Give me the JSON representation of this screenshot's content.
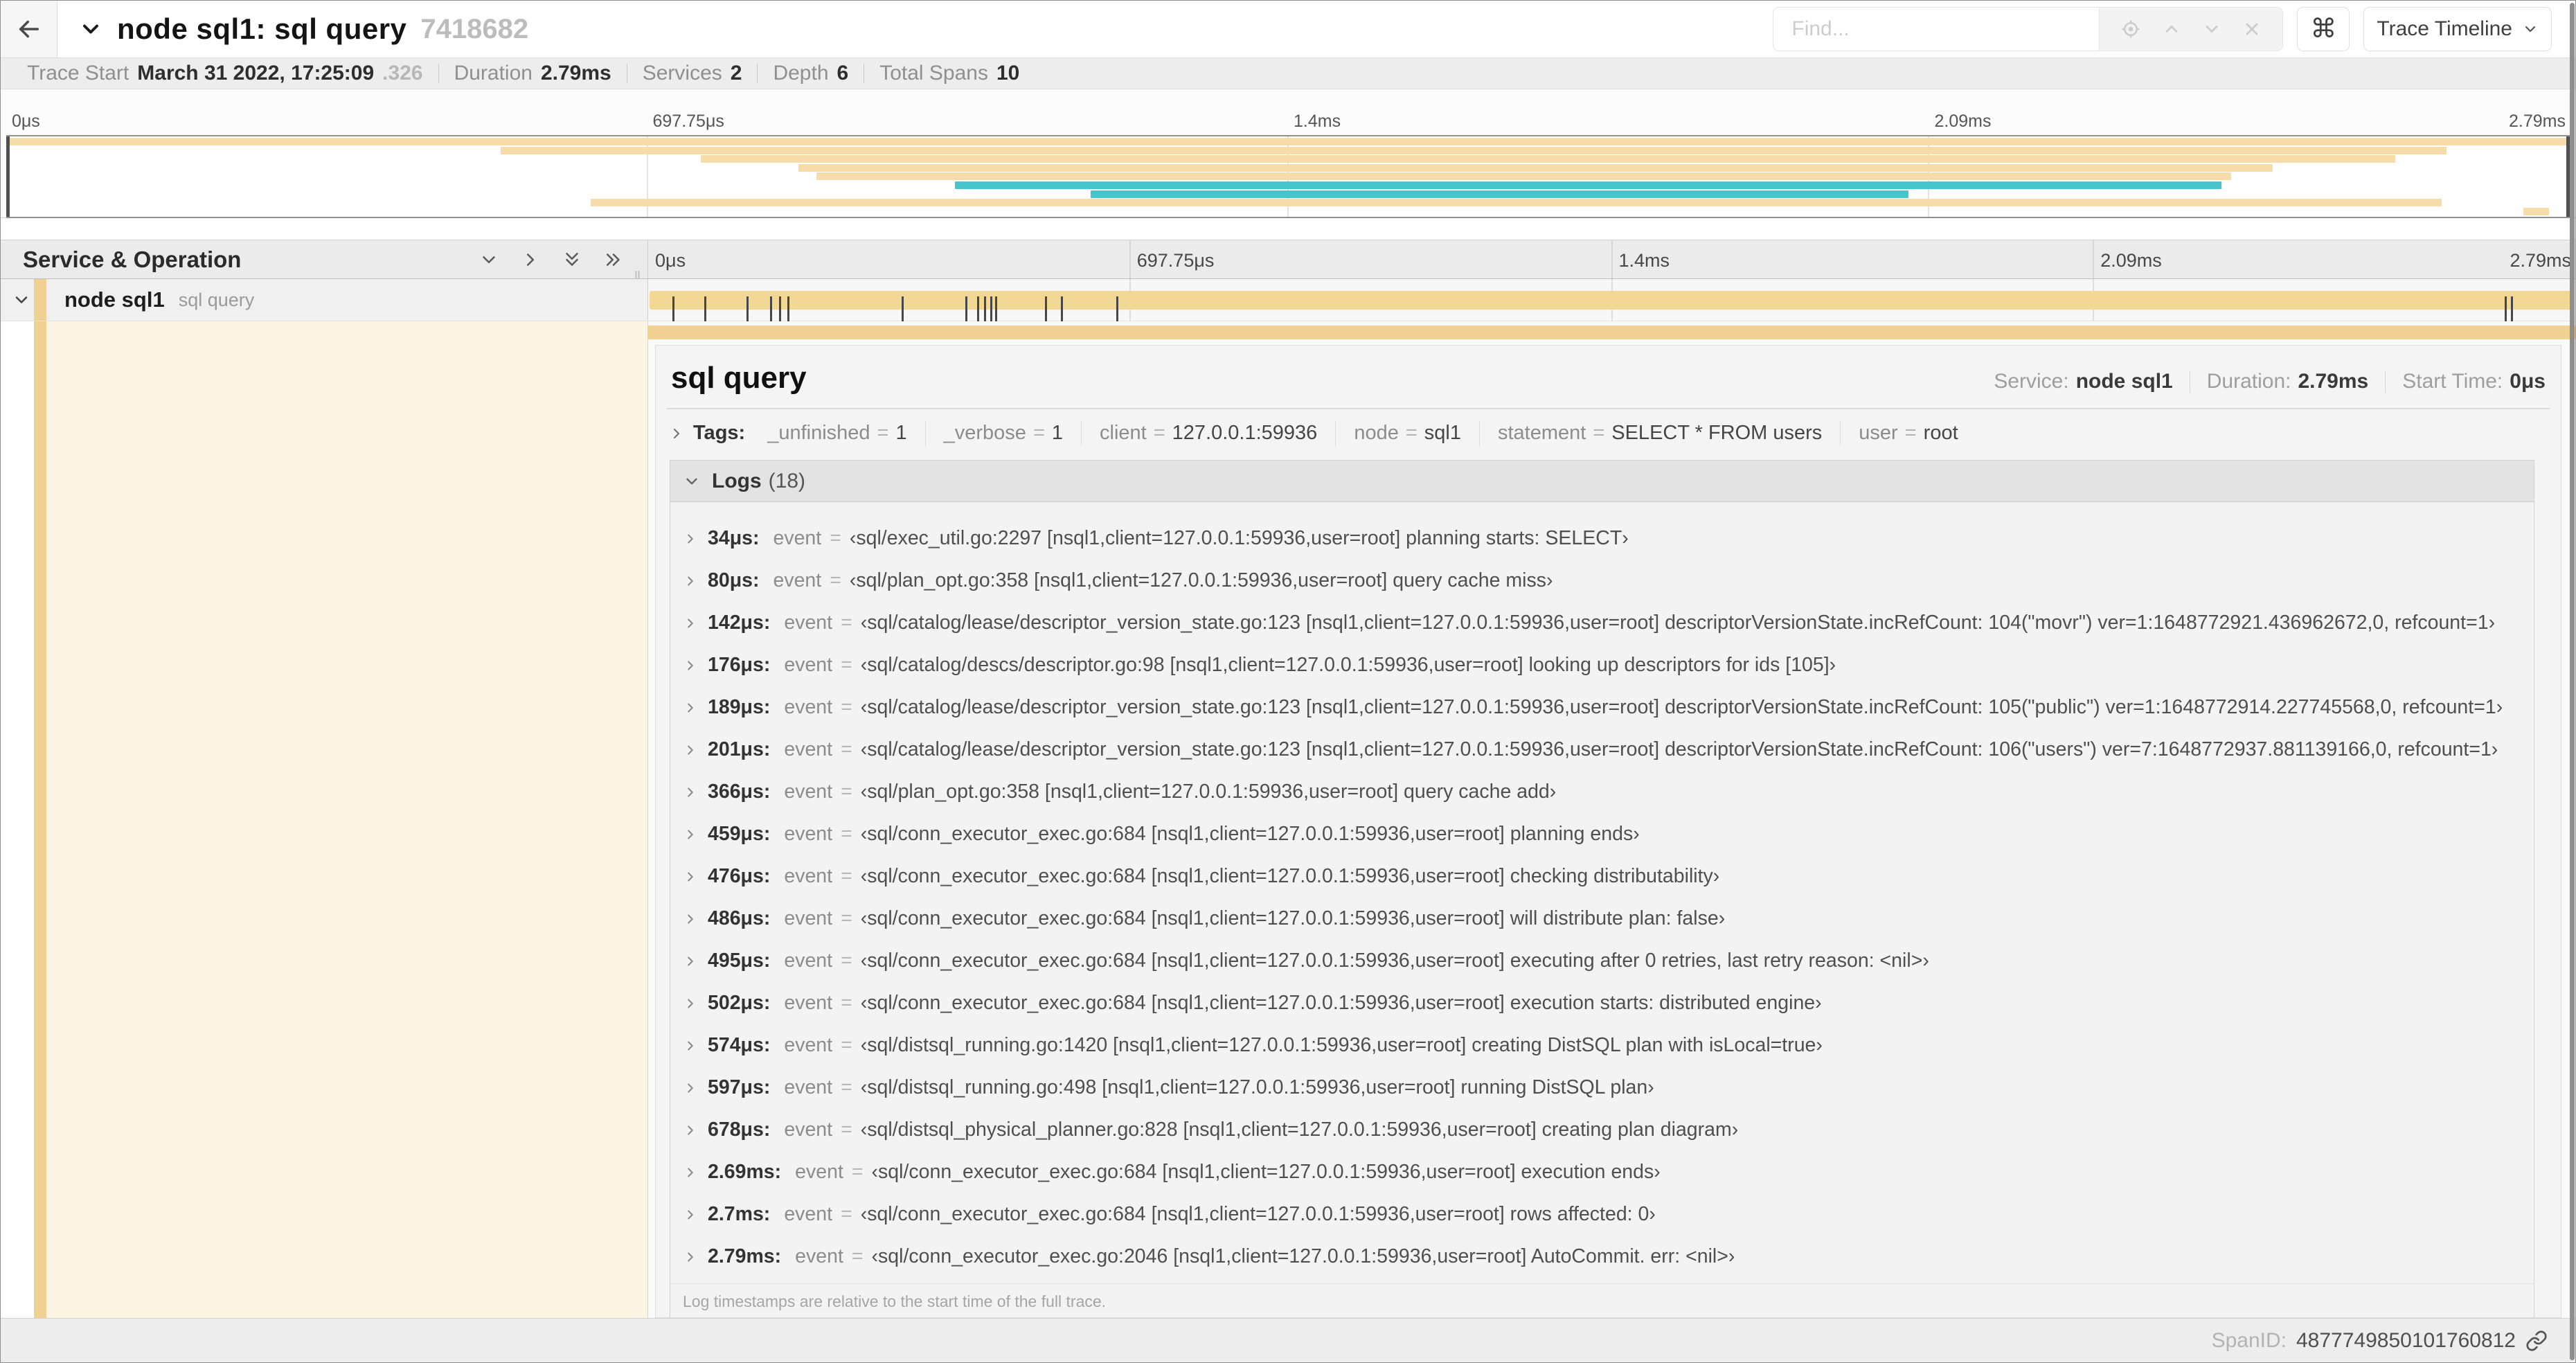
{
  "nav": {
    "title": "node sql1: sql query",
    "trace_id": "7418682",
    "find_placeholder": "Find...",
    "shortcut_icon": "⌘",
    "view_selector": "Trace Timeline"
  },
  "stats": [
    {
      "label": "Trace Start",
      "value": "March 31 2022, 17:25:09",
      "suffix": ".326"
    },
    {
      "label": "Duration",
      "value": "2.79ms"
    },
    {
      "label": "Services",
      "value": "2"
    },
    {
      "label": "Depth",
      "value": "6"
    },
    {
      "label": "Total Spans",
      "value": "10"
    }
  ],
  "ruler": [
    {
      "label": "0μs",
      "pct": 0
    },
    {
      "label": "697.75μs",
      "pct": 25
    },
    {
      "label": "1.4ms",
      "pct": 50
    },
    {
      "label": "2.09ms",
      "pct": 75
    },
    {
      "label": "2.79ms",
      "pct": 100
    }
  ],
  "minimap_spans": [
    {
      "start": 0,
      "end": 100,
      "color": "tan"
    },
    {
      "start": 19.3,
      "end": 95.2,
      "color": "tan"
    },
    {
      "start": 27.1,
      "end": 93.2,
      "color": "tan"
    },
    {
      "start": 30.9,
      "end": 88.4,
      "color": "tan"
    },
    {
      "start": 31.6,
      "end": 86.8,
      "color": "tan"
    },
    {
      "start": 37.0,
      "end": 86.4,
      "color": "teal"
    },
    {
      "start": 42.3,
      "end": 74.2,
      "color": "teal"
    },
    {
      "start": 22.8,
      "end": 95.0,
      "color": "tan"
    },
    {
      "start": 98.2,
      "end": 99.2,
      "color": "tan"
    }
  ],
  "column_header": "Service & Operation",
  "row": {
    "service": "node sql1",
    "operation": "sql query"
  },
  "detail": {
    "operation": "sql query",
    "meta": [
      {
        "label": "Service:",
        "value": "node sql1"
      },
      {
        "label": "Duration:",
        "value": "2.79ms"
      },
      {
        "label": "Start Time:",
        "value": "0μs"
      }
    ],
    "tags_label": "Tags:",
    "tags": [
      {
        "key": "_unfinished",
        "value": "1"
      },
      {
        "key": "_verbose",
        "value": "1"
      },
      {
        "key": "client",
        "value": "127.0.0.1:59936"
      },
      {
        "key": "node",
        "value": "sql1"
      },
      {
        "key": "statement",
        "value": "SELECT * FROM users"
      },
      {
        "key": "user",
        "value": "root"
      }
    ],
    "logs_label": "Logs",
    "logs_count": "(18)",
    "logs": [
      {
        "time": "34μs:",
        "pct": 1.22,
        "field": "event",
        "value": "‹sql/exec_util.go:2297 [nsql1,client=127.0.0.1:59936,user=root] planning starts: SELECT›"
      },
      {
        "time": "80μs:",
        "pct": 2.87,
        "field": "event",
        "value": "‹sql/plan_opt.go:358 [nsql1,client=127.0.0.1:59936,user=root] query cache miss›"
      },
      {
        "time": "142μs:",
        "pct": 5.09,
        "field": "event",
        "value": "‹sql/catalog/lease/descriptor_version_state.go:123 [nsql1,client=127.0.0.1:59936,user=root] descriptorVersionState.incRefCount: 104(\"movr\") ver=1:1648772921.436962672,0, refcount=1›"
      },
      {
        "time": "176μs:",
        "pct": 6.31,
        "field": "event",
        "value": "‹sql/catalog/descs/descriptor.go:98 [nsql1,client=127.0.0.1:59936,user=root] looking up descriptors for ids [105]›"
      },
      {
        "time": "189μs:",
        "pct": 6.77,
        "field": "event",
        "value": "‹sql/catalog/lease/descriptor_version_state.go:123 [nsql1,client=127.0.0.1:59936,user=root] descriptorVersionState.incRefCount: 105(\"public\") ver=1:1648772914.227745568,0, refcount=1›"
      },
      {
        "time": "201μs:",
        "pct": 7.2,
        "field": "event",
        "value": "‹sql/catalog/lease/descriptor_version_state.go:123 [nsql1,client=127.0.0.1:59936,user=root] descriptorVersionState.incRefCount: 106(\"users\") ver=7:1648772937.881139166,0, refcount=1›"
      },
      {
        "time": "366μs:",
        "pct": 13.12,
        "field": "event",
        "value": "‹sql/plan_opt.go:358 [nsql1,client=127.0.0.1:59936,user=root] query cache add›"
      },
      {
        "time": "459μs:",
        "pct": 16.45,
        "field": "event",
        "value": "‹sql/conn_executor_exec.go:684 [nsql1,client=127.0.0.1:59936,user=root] planning ends›"
      },
      {
        "time": "476μs:",
        "pct": 17.06,
        "field": "event",
        "value": "‹sql/conn_executor_exec.go:684 [nsql1,client=127.0.0.1:59936,user=root] checking distributability›"
      },
      {
        "time": "486μs:",
        "pct": 17.42,
        "field": "event",
        "value": "‹sql/conn_executor_exec.go:684 [nsql1,client=127.0.0.1:59936,user=root] will distribute plan: false›"
      },
      {
        "time": "495μs:",
        "pct": 17.74,
        "field": "event",
        "value": "‹sql/conn_executor_exec.go:684 [nsql1,client=127.0.0.1:59936,user=root] executing after 0 retries, last retry reason: <nil>›"
      },
      {
        "time": "502μs:",
        "pct": 18.0,
        "field": "event",
        "value": "‹sql/conn_executor_exec.go:684 [nsql1,client=127.0.0.1:59936,user=root] execution starts: distributed engine›"
      },
      {
        "time": "574μs:",
        "pct": 20.57,
        "field": "event",
        "value": "‹sql/distsql_running.go:1420 [nsql1,client=127.0.0.1:59936,user=root] creating DistSQL plan with isLocal=true›"
      },
      {
        "time": "597μs:",
        "pct": 21.4,
        "field": "event",
        "value": "‹sql/distsql_running.go:498 [nsql1,client=127.0.0.1:59936,user=root] running DistSQL plan›"
      },
      {
        "time": "678μs:",
        "pct": 24.3,
        "field": "event",
        "value": "‹sql/distsql_physical_planner.go:828 [nsql1,client=127.0.0.1:59936,user=root] creating plan diagram›"
      },
      {
        "time": "2.69ms:",
        "pct": 96.42,
        "field": "event",
        "value": "‹sql/conn_executor_exec.go:684 [nsql1,client=127.0.0.1:59936,user=root] execution ends›"
      },
      {
        "time": "2.7ms:",
        "pct": 96.77,
        "field": "event",
        "value": "‹sql/conn_executor_exec.go:684 [nsql1,client=127.0.0.1:59936,user=root] rows affected: 0›"
      },
      {
        "time": "2.79ms:",
        "pct": 99.9,
        "field": "event",
        "value": "‹sql/conn_executor_exec.go:2046 [nsql1,client=127.0.0.1:59936,user=root] AutoCommit. err: <nil>›"
      }
    ],
    "logs_note": "Log timestamps are relative to the start time of the full trace."
  },
  "footer": {
    "label": "SpanID:",
    "value": "4877749850101760812"
  },
  "colors": {
    "span_tan": "#f5dcaa",
    "span_teal": "#48c5cc",
    "accent_amber": "#f0d093",
    "span_bar": "#f3d795"
  }
}
